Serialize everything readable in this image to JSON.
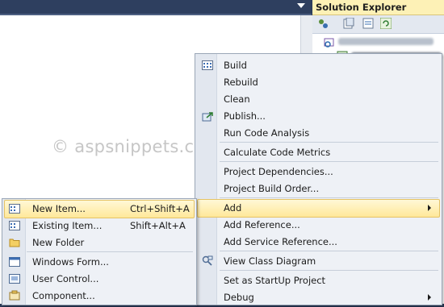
{
  "watermark": "© aspsnippets.com",
  "solution_explorer": {
    "title": "Solution Explorer"
  },
  "main_menu": {
    "items": [
      {
        "label": "Build",
        "icon": "build-icon"
      },
      {
        "label": "Rebuild"
      },
      {
        "label": "Clean"
      },
      {
        "label": "Publish...",
        "icon": "publish-icon"
      },
      {
        "label": "Run Code Analysis"
      },
      {
        "label": "Calculate Code Metrics"
      },
      {
        "label": "Project Dependencies..."
      },
      {
        "label": "Project Build Order..."
      },
      {
        "label": "Add",
        "submenu": true,
        "highlighted": true
      },
      {
        "label": "Add Reference..."
      },
      {
        "label": "Add Service Reference..."
      },
      {
        "label": "View Class Diagram",
        "icon": "class-diagram-icon"
      },
      {
        "label": "Set as StartUp Project"
      },
      {
        "label": "Debug",
        "submenu": true
      }
    ]
  },
  "add_submenu": {
    "items": [
      {
        "label": "New Item...",
        "shortcut": "Ctrl+Shift+A",
        "icon": "new-item-icon",
        "highlighted": true
      },
      {
        "label": "Existing Item...",
        "shortcut": "Shift+Alt+A",
        "icon": "existing-item-icon"
      },
      {
        "label": "New Folder",
        "icon": "folder-icon"
      },
      {
        "label": "Windows Form...",
        "icon": "windows-form-icon"
      },
      {
        "label": "User Control...",
        "icon": "user-control-icon"
      },
      {
        "label": "Component...",
        "icon": "component-icon"
      }
    ]
  },
  "colors": {
    "highlight": "#ffe89a",
    "title_bar": "#fdf1b6",
    "chrome": "#2e3f5f"
  }
}
